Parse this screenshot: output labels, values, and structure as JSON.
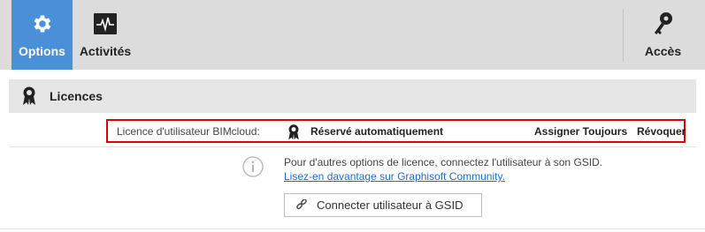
{
  "toolbar": {
    "tabs": [
      {
        "label": "Options",
        "icon": "gear-icon",
        "active": true
      },
      {
        "label": "Activités",
        "icon": "activity-monitor-icon",
        "active": false
      }
    ],
    "right_tab": {
      "label": "Accès",
      "icon": "key-icon"
    },
    "active_color": "#4a90d9"
  },
  "section": {
    "title": "Licences",
    "icon": "license-ribbon-icon"
  },
  "license_row": {
    "label": "Licence d'utilisateur BIMcloud:",
    "status_icon": "license-ribbon-icon",
    "status": "Réservé automatiquement",
    "assign_label": "Assigner Toujours",
    "revoke_label": "Révoquer",
    "highlight_color": "#e00000"
  },
  "info": {
    "icon": "info-icon",
    "text": "Pour d'autres options de licence, connectez l'utilisateur à son GSID.",
    "link": "Lisez-en davantage sur Graphisoft Community."
  },
  "connect_button": {
    "label": "Connecter utilisateur à GSID",
    "icon": "link-icon"
  }
}
